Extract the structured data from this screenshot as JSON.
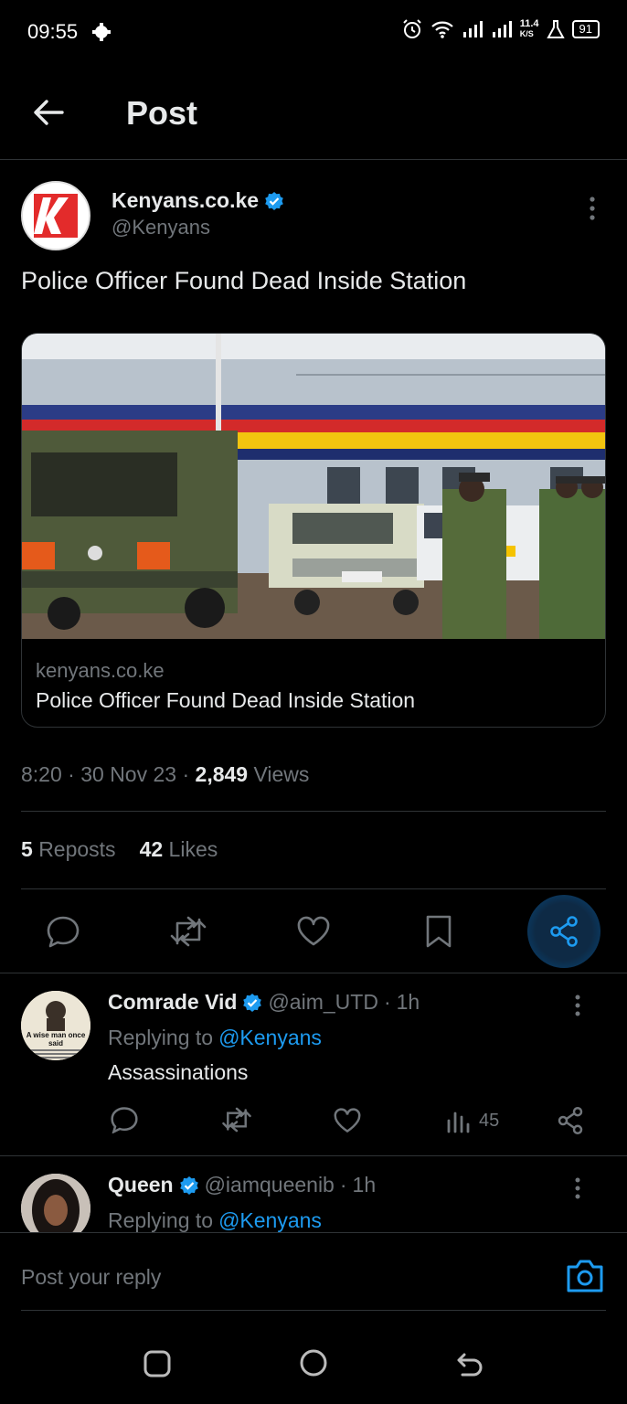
{
  "status_bar": {
    "time": "09:55",
    "network_speed_top": "11.4",
    "network_speed_bottom": "K/S",
    "battery": "91"
  },
  "header": {
    "title": "Post"
  },
  "post": {
    "author_name": "Kenyans.co.ke",
    "author_handle": "@Kenyans",
    "text": "Police Officer Found Dead Inside Station",
    "card": {
      "domain": "kenyans.co.ke",
      "title": "Police Officer Found Dead Inside Station"
    },
    "meta": {
      "time": "8:20",
      "date": "30 Nov 23",
      "views_count": "2,849",
      "views_label": "Views"
    },
    "stats": {
      "reposts_count": "5",
      "reposts_label": "Reposts",
      "likes_count": "42",
      "likes_label": "Likes"
    }
  },
  "replies": [
    {
      "name": "Comrade Vid",
      "handle": "@aim_UTD",
      "time": "1h",
      "replying_prefix": "Replying to",
      "replying_to": "@Kenyans",
      "text": "Assassinations",
      "views": "45",
      "avatar_caption": "A wise man once said"
    },
    {
      "name": "Queen",
      "handle": "@iamqueenib",
      "time": "1h",
      "replying_prefix": "Replying to",
      "replying_to": "@Kenyans"
    }
  ],
  "reply_bar": {
    "placeholder": "Post your reply"
  },
  "colors": {
    "accent": "#1d9bf0",
    "background": "#000000",
    "muted": "#71767b",
    "divider": "#2f3336"
  },
  "icons": [
    "back-arrow-icon",
    "verified-icon",
    "more-icon",
    "reply-icon",
    "repost-icon",
    "like-icon",
    "bookmark-icon",
    "share-icon",
    "views-icon",
    "camera-icon",
    "recents-icon",
    "home-icon",
    "back-nav-icon"
  ]
}
